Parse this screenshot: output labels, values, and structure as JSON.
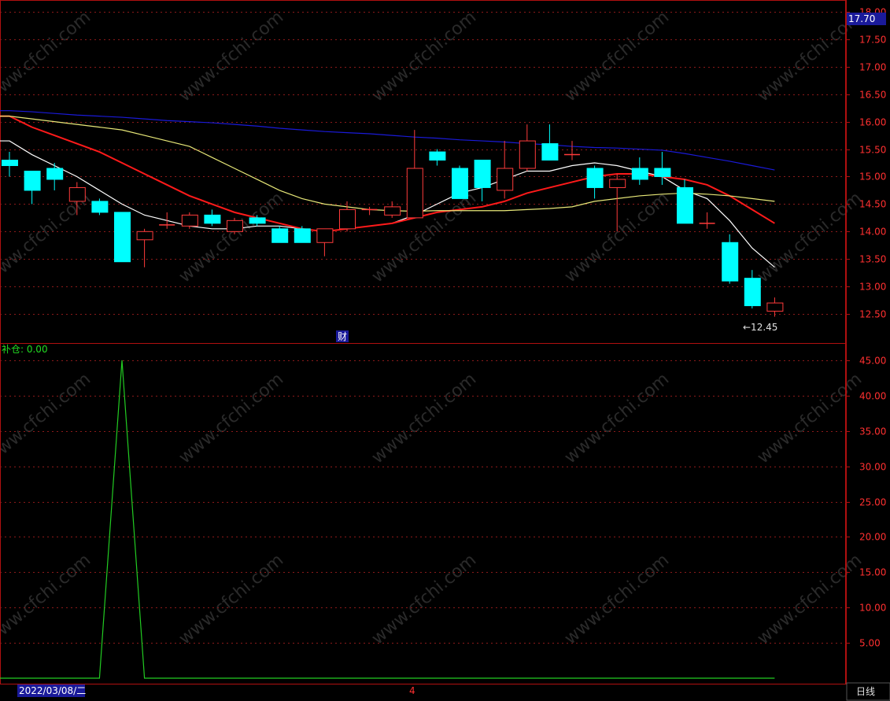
{
  "chart_data": [
    {
      "type": "candlestick",
      "panel": "price",
      "ylim": [
        12.2,
        18.1
      ],
      "y_ticks": [
        "18.00",
        "17.50",
        "17.00",
        "16.50",
        "16.00",
        "15.50",
        "15.00",
        "14.50",
        "14.00",
        "13.50",
        "13.00",
        "12.50"
      ],
      "current_price_label": "17.70",
      "low_marker_label": "←12.45",
      "finance_marker_label": "财",
      "candles": [
        {
          "o": 15.3,
          "h": 15.45,
          "l": 15.0,
          "c": 15.2
        },
        {
          "o": 15.1,
          "h": 15.1,
          "l": 14.5,
          "c": 14.75
        },
        {
          "o": 15.15,
          "h": 15.25,
          "l": 14.75,
          "c": 14.95
        },
        {
          "o": 14.55,
          "h": 14.9,
          "l": 14.3,
          "c": 14.8
        },
        {
          "o": 14.55,
          "h": 14.6,
          "l": 14.3,
          "c": 14.35
        },
        {
          "o": 14.35,
          "h": 14.35,
          "l": 13.45,
          "c": 13.45
        },
        {
          "o": 13.85,
          "h": 14.05,
          "l": 13.35,
          "c": 14.0
        },
        {
          "o": 14.1,
          "h": 14.35,
          "l": 14.05,
          "c": 14.12
        },
        {
          "o": 14.1,
          "h": 14.35,
          "l": 14.05,
          "c": 14.3
        },
        {
          "o": 14.3,
          "h": 14.4,
          "l": 14.1,
          "c": 14.15
        },
        {
          "o": 14.0,
          "h": 14.25,
          "l": 13.95,
          "c": 14.2
        },
        {
          "o": 14.25,
          "h": 14.3,
          "l": 14.1,
          "c": 14.15
        },
        {
          "o": 14.05,
          "h": 14.1,
          "l": 13.8,
          "c": 13.8
        },
        {
          "o": 14.05,
          "h": 14.1,
          "l": 13.8,
          "c": 13.8
        },
        {
          "o": 13.8,
          "h": 14.0,
          "l": 13.55,
          "c": 14.05
        },
        {
          "o": 14.05,
          "h": 14.55,
          "l": 14.0,
          "c": 14.4
        },
        {
          "o": 14.4,
          "h": 14.45,
          "l": 14.3,
          "c": 14.4
        },
        {
          "o": 14.3,
          "h": 14.55,
          "l": 14.25,
          "c": 14.45
        },
        {
          "o": 14.25,
          "h": 15.85,
          "l": 14.25,
          "c": 15.15
        },
        {
          "o": 15.45,
          "h": 15.5,
          "l": 15.2,
          "c": 15.3
        },
        {
          "o": 15.15,
          "h": 15.2,
          "l": 14.6,
          "c": 14.6
        },
        {
          "o": 15.3,
          "h": 15.3,
          "l": 14.55,
          "c": 14.8
        },
        {
          "o": 14.75,
          "h": 15.65,
          "l": 14.6,
          "c": 15.15
        },
        {
          "o": 15.15,
          "h": 15.95,
          "l": 15.1,
          "c": 15.65
        },
        {
          "o": 15.6,
          "h": 15.95,
          "l": 15.3,
          "c": 15.3
        },
        {
          "o": 15.4,
          "h": 15.65,
          "l": 15.3,
          "c": 15.4
        },
        {
          "o": 15.15,
          "h": 15.2,
          "l": 14.6,
          "c": 14.8
        },
        {
          "o": 14.8,
          "h": 15.05,
          "l": 14.0,
          "c": 14.95
        },
        {
          "o": 15.15,
          "h": 15.35,
          "l": 14.85,
          "c": 14.95
        },
        {
          "o": 15.15,
          "h": 15.45,
          "l": 14.85,
          "c": 15.0
        },
        {
          "o": 14.8,
          "h": 14.95,
          "l": 14.15,
          "c": 14.15
        },
        {
          "o": 14.15,
          "h": 14.35,
          "l": 14.05,
          "c": 14.15
        },
        {
          "o": 13.8,
          "h": 13.95,
          "l": 13.05,
          "c": 13.1
        },
        {
          "o": 13.15,
          "h": 13.3,
          "l": 12.6,
          "c": 12.65
        },
        {
          "o": 12.55,
          "h": 12.8,
          "l": 12.45,
          "c": 12.7
        }
      ],
      "ma_lines": [
        {
          "color": "#ffffff",
          "values": [
            15.65,
            15.4,
            15.2,
            15.0,
            14.75,
            14.5,
            14.3,
            14.2,
            14.1,
            14.05,
            14.05,
            14.1,
            14.1,
            14.05,
            14.0,
            14.05,
            14.1,
            14.15,
            14.3,
            14.5,
            14.7,
            14.8,
            14.95,
            15.1,
            15.1,
            15.2,
            15.25,
            15.2,
            15.1,
            15.0,
            14.75,
            14.6,
            14.2,
            13.7,
            13.35
          ]
        },
        {
          "color": "#ff1a1a",
          "values": [
            16.1,
            15.9,
            15.75,
            15.6,
            15.45,
            15.25,
            15.05,
            14.85,
            14.65,
            14.5,
            14.35,
            14.25,
            14.15,
            14.05,
            14.0,
            14.05,
            14.1,
            14.15,
            14.25,
            14.35,
            14.4,
            14.45,
            14.55,
            14.7,
            14.8,
            14.9,
            15.0,
            15.05,
            15.05,
            15.0,
            14.95,
            14.85,
            14.65,
            14.4,
            14.15
          ]
        },
        {
          "color": "#e8e878",
          "values": [
            16.1,
            16.05,
            16.0,
            15.95,
            15.9,
            15.85,
            15.75,
            15.65,
            15.55,
            15.35,
            15.15,
            14.95,
            14.75,
            14.6,
            14.5,
            14.45,
            14.4,
            14.38,
            14.37,
            14.38,
            14.38,
            14.38,
            14.38,
            14.4,
            14.42,
            14.45,
            14.55,
            14.6,
            14.65,
            14.68,
            14.7,
            14.68,
            14.65,
            14.6,
            14.55
          ]
        },
        {
          "color": "#1a1ad8",
          "values": [
            16.2,
            16.18,
            16.15,
            16.12,
            16.1,
            16.08,
            16.05,
            16.02,
            16.0,
            15.98,
            15.95,
            15.92,
            15.88,
            15.85,
            15.82,
            15.8,
            15.78,
            15.75,
            15.72,
            15.7,
            15.67,
            15.65,
            15.63,
            15.6,
            15.58,
            15.55,
            15.53,
            15.52,
            15.5,
            15.48,
            15.42,
            15.35,
            15.28,
            15.2,
            15.12
          ]
        }
      ]
    },
    {
      "type": "line",
      "panel": "indicator",
      "indicator_label": "补仓: 0.00",
      "ylim": [
        0,
        47
      ],
      "y_ticks": [
        "45.00",
        "40.00",
        "35.00",
        "30.00",
        "25.00",
        "20.00",
        "15.00",
        "10.00",
        "5.00"
      ],
      "x_start_label": "2022/03/08/二",
      "x_marker_label": "4",
      "period_label": "日线",
      "series": [
        {
          "color": "#22cc22",
          "values": [
            0,
            0,
            0,
            0,
            0,
            45,
            0,
            0,
            0,
            0,
            0,
            0,
            0,
            0,
            0,
            0,
            0,
            0,
            0,
            0,
            0,
            0,
            0,
            0,
            0,
            0,
            0,
            0,
            0,
            0,
            0,
            0,
            0,
            0,
            0
          ]
        }
      ]
    }
  ],
  "watermark": "www.cfchi.com",
  "colors": {
    "up": "#ff3b3b",
    "down": "#00ffff",
    "grid": "#8b1a1a",
    "axis": "#b01010",
    "label_red": "#ff3030"
  }
}
